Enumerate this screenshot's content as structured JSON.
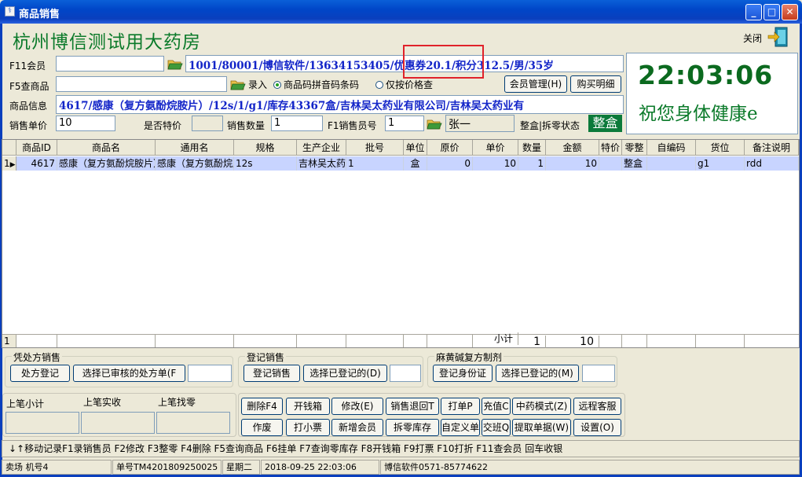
{
  "window": {
    "title": "商品销售"
  },
  "store_name": "杭州博信测试用大药房",
  "close_label": "关闭",
  "member": {
    "label": "F11会员",
    "value": "",
    "info": "1001/80001/博信软件/13634153405/优惠券20.1/积分312.5/男/35岁"
  },
  "product_search": {
    "label": "F5查商品",
    "value": "",
    "entry_label": "录入",
    "option_code": "商品码拼音码条码",
    "option_price": "仅按价格查"
  },
  "buttons_top": {
    "member_mgmt": "会员管理(H)",
    "purchase_detail": "购买明细"
  },
  "product_info": {
    "label": "商品信息",
    "value": "4617/感康（复方氨酚烷胺片）/12s/1/g1/库存43367盒/吉林吴太药业有限公司/吉林吴太药业有"
  },
  "sale_row": {
    "unit_price_label": "销售单价",
    "unit_price": "10",
    "special_label": "是否特价",
    "special_value": "",
    "qty_label": "销售数量",
    "qty": "1",
    "clerk_label": "F1销售员号",
    "clerk_no": "1",
    "clerk_name": "张一",
    "status_label": "整盒|拆零状态",
    "status_value": "整盒"
  },
  "clock": "22:03:06",
  "wish": "祝您身体健康e",
  "grid": {
    "headers": [
      "商品ID",
      "商品名",
      "通用名",
      "规格",
      "生产企业",
      "批号",
      "单位",
      "原价",
      "单价",
      "数量",
      "金额",
      "特价",
      "零整",
      "自编码",
      "货位",
      "备注说明"
    ],
    "rows": [
      {
        "index": "1",
        "cells": [
          "4617",
          "感康（复方氨酚烷胺片）",
          "感康（复方氨酚烷胺片）",
          "12s",
          "吉林吴太药业",
          "1",
          "盒",
          "0",
          "10",
          "1",
          "10",
          "",
          "整盒",
          "",
          "g1",
          "rdd"
        ]
      }
    ],
    "footer": {
      "index": "1",
      "subtotal_label": "小计",
      "qty": "1",
      "amount": "10"
    }
  },
  "prescription": {
    "title": "凭处方销售",
    "register": "处方登记",
    "select": "选择已审核的处方单(F",
    "value": ""
  },
  "registered_sale": {
    "title": "登记销售",
    "register": "登记销售",
    "select": "选择已登记的(D)",
    "value": ""
  },
  "ephedrine": {
    "title": "麻黄碱复方制剂",
    "register": "登记身份证",
    "select": "选择已登记的(M)",
    "value": ""
  },
  "last_sale": {
    "subtotal_label": "上笔小计",
    "received_label": "上笔实收",
    "change_label": "上笔找零",
    "subtotal": "",
    "received": "",
    "change": ""
  },
  "action_buttons": [
    [
      "删除F4",
      "开钱箱",
      "修改(E)",
      "销售退回T",
      "打单P",
      "充值C",
      "中药模式(Z)",
      "远程客服"
    ],
    [
      "作废",
      "打小票",
      "新增会员",
      "拆零库存",
      "自定义单",
      "交班Q",
      "提取单据(W)",
      "设置(O)"
    ]
  ],
  "shortcuts": "↓↑移动记录F1录销售员 F2修改 F3整零 F4删除 F5查询商品 F6挂单 F7查询零库存 F8开钱箱 F9打票 F10打折 F11查会员 回车收银",
  "statusbar": [
    "卖场 机号4",
    "单号TM4201809250025",
    "星期二",
    "2018-09-25 22:03:06",
    "博信软件0571-85774622"
  ]
}
